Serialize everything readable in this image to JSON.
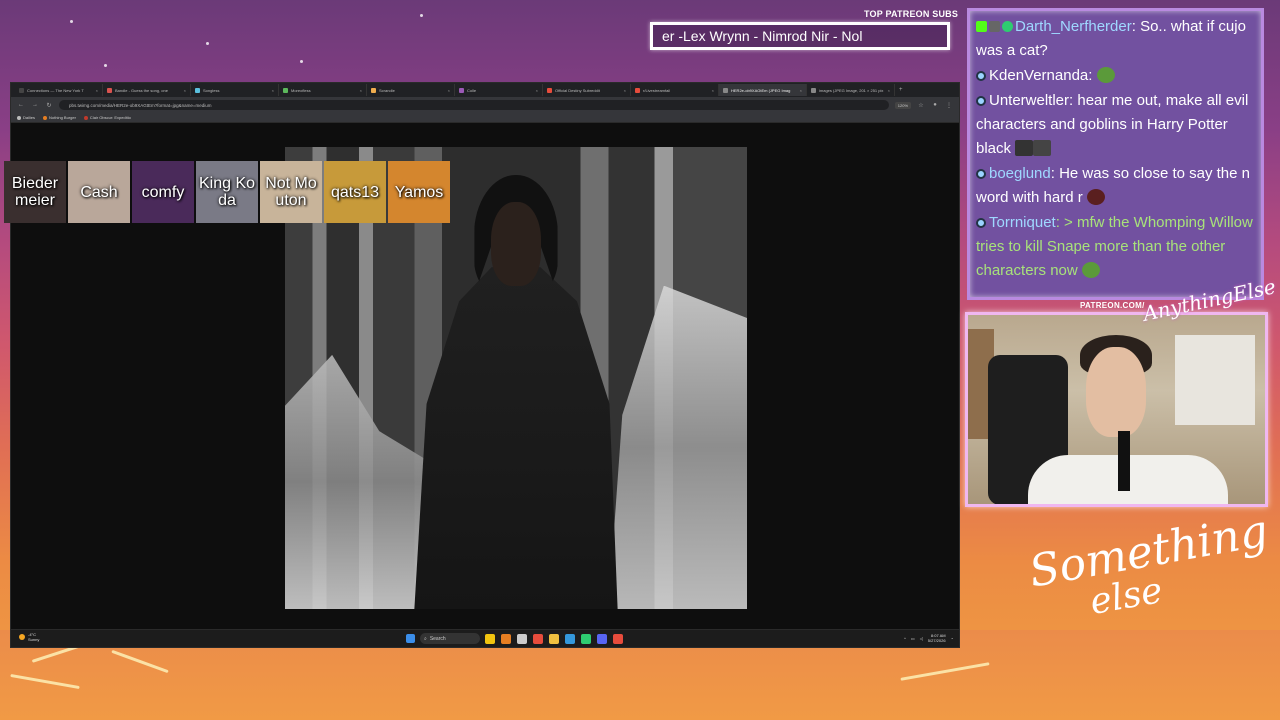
{
  "overlay": {
    "patreon_label": "TOP PATREON SUBS",
    "patreon_ticker": "er -Lex Wrynn - Nimrod Nir - Nol",
    "cam_label": "PATREON.COM/",
    "cam_signature": "AnythingElse",
    "logo_line1": "Something",
    "logo_line2": "else"
  },
  "browser": {
    "tabs": [
      {
        "label": "Connections — The New York T",
        "color": "#444"
      },
      {
        "label": "Bandle - Guess the song, one",
        "color": "#d9534f"
      },
      {
        "label": "Songless",
        "color": "#5bc0de"
      },
      {
        "label": "Moreofless",
        "color": "#5cb85c"
      },
      {
        "label": "Scrandle",
        "color": "#f0ad4e"
      },
      {
        "label": "Colle",
        "color": "#9b59b6"
      },
      {
        "label": "Official Destiny Subreddit",
        "color": "#e74c3c"
      },
      {
        "label": "r/Livestreamfail",
        "color": "#e74c3c"
      },
      {
        "label": "HER2e-ob9XAGtEm (JPEG Imag",
        "color": "#888"
      },
      {
        "label": "images (JPEG Image, 201 × 251 pix",
        "color": "#888"
      }
    ],
    "new_tab": "+",
    "url": "pbs.twimg.com/media/HER2e-ob9XAGtEm?format=jpg&name=medium",
    "zoom": "120%",
    "bookmarks": [
      {
        "label": "Dailies",
        "color": "#bbb"
      },
      {
        "label": "Nothing Burger",
        "color": "#e67e22"
      },
      {
        "label": "Clair Obscur: Expeditio",
        "color": "#c0392b"
      }
    ],
    "nav": {
      "back": "←",
      "forward": "→",
      "reload": "↻"
    }
  },
  "subs": [
    {
      "name": "Biedermeier",
      "color": "#3a2f2f"
    },
    {
      "name": "Cash",
      "color": "#b9a79a"
    },
    {
      "name": "comfy",
      "color": "#4a2a5a"
    },
    {
      "name": "King Koda",
      "color": "#7a7a86"
    },
    {
      "name": "Not Mouton",
      "color": "#c8b49a"
    },
    {
      "name": "qats13",
      "color": "#c79a3a"
    },
    {
      "name": "Yamos",
      "color": "#d4862e"
    }
  ],
  "taskbar": {
    "weather_temp": "-4°C",
    "weather_desc": "Sunny",
    "search": "Search",
    "time": "8:07 AM",
    "date": "5/27/2026",
    "icons": [
      "#f1c40f",
      "#e67e22",
      "#ccc",
      "#e74c3c",
      "#f0c040",
      "#3498db",
      "#2ecc71",
      "#5865f2",
      "#e74c3c"
    ]
  },
  "chat": {
    "messages": [
      {
        "user": "Darth_Nerfherder",
        "text": "So.. what if cujo was a cat?",
        "user_color": "#9fd8ff"
      },
      {
        "user": "KdenVernanda",
        "text": "",
        "user_color": "#ffffff"
      },
      {
        "user": "Unterweltler",
        "text": "hear me out, make all evil characters and goblins in Harry Potter black",
        "user_color": "#ffffff"
      },
      {
        "user": "boeglund",
        "text": "He was so close to say the n word with hard r",
        "user_color": "#9fd8ff"
      },
      {
        "user": "Torrniquet",
        "text": "> mfw the Whomping Willow tries to kill Snape more than the other characters now",
        "user_color": "#9fd8ff"
      }
    ]
  }
}
